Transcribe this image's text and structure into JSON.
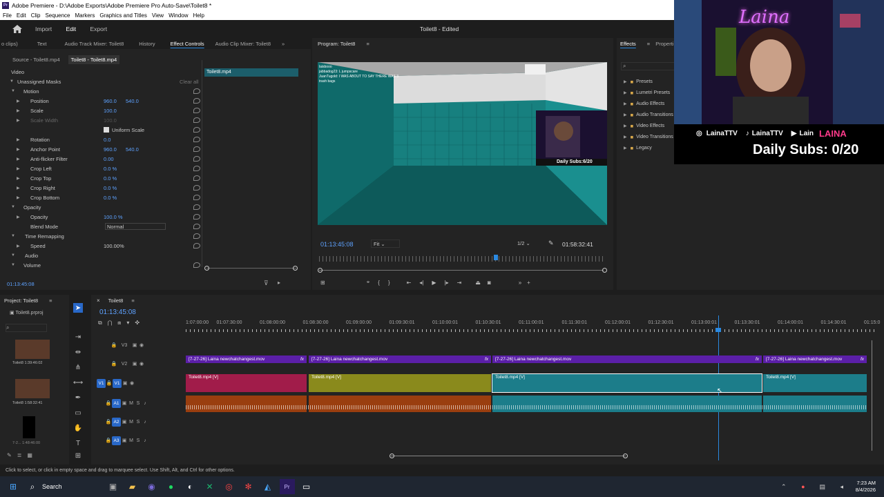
{
  "window": {
    "title": "Adobe Premiere - D:\\Adobe Exports\\Adobe Premiere Pro Auto-Save\\Toilet8 *",
    "logo": "Pr"
  },
  "menu": [
    "File",
    "Edit",
    "Clip",
    "Sequence",
    "Markers",
    "Graphics and Titles",
    "View",
    "Window",
    "Help"
  ],
  "appbar": {
    "import": "Import",
    "edit": "Edit",
    "export": "Export",
    "doc": "Toilet8 - Edited"
  },
  "panel_tabs": {
    "clips": "o clips)",
    "text": "Text",
    "audio_track_mixer": "Audio Track Mixer: Toilet8",
    "history": "History",
    "effect_controls": "Effect Controls",
    "audio_clip_mixer": "Audio Clip Mixer: Toilet8",
    "program": "Program: Toilet8",
    "effects": "Effects",
    "properties": "Properti"
  },
  "effect_controls": {
    "source": "Source - Toilet8.mp4",
    "seq": "Toilet8 - Toilet8.mp4",
    "clip": "Toilet8.mp4",
    "video": "Video",
    "masks": "Unassigned Masks",
    "clear_all": "Clear all",
    "rows": [
      {
        "label": "Motion",
        "v1": "",
        "v2": ""
      },
      {
        "label": "Position",
        "v1": "960.0",
        "v2": "540.0"
      },
      {
        "label": "Scale",
        "v1": "100.0",
        "v2": ""
      },
      {
        "label": "Scale Width",
        "v1": "100.0",
        "v2": ""
      },
      {
        "label": "Uniform Scale",
        "v1": "",
        "v2": ""
      },
      {
        "label": "Rotation",
        "v1": "0.0",
        "v2": ""
      },
      {
        "label": "Anchor Point",
        "v1": "960.0",
        "v2": "540.0"
      },
      {
        "label": "Anti-flicker Filter",
        "v1": "0.00",
        "v2": ""
      },
      {
        "label": "Crop Left",
        "v1": "0.0 %",
        "v2": ""
      },
      {
        "label": "Crop Top",
        "v1": "0.0 %",
        "v2": ""
      },
      {
        "label": "Crop Right",
        "v1": "0.0 %",
        "v2": ""
      },
      {
        "label": "Crop Bottom",
        "v1": "0.0 %",
        "v2": ""
      },
      {
        "label": "Opacity",
        "v1": "",
        "v2": ""
      },
      {
        "label": "Opacity",
        "v1": "100.0 %",
        "v2": ""
      },
      {
        "label": "Blend Mode",
        "v1": "Normal",
        "v2": ""
      },
      {
        "label": "Time Remapping",
        "v1": "",
        "v2": ""
      },
      {
        "label": "Speed",
        "v1": "100.00%",
        "v2": ""
      },
      {
        "label": "Audio",
        "v1": "",
        "v2": ""
      },
      {
        "label": "Volume",
        "v1": "",
        "v2": ""
      }
    ],
    "timecode": "01:13:45:08"
  },
  "program": {
    "timecode": "01:13:45:08",
    "fit": "Fit",
    "res": "1/2",
    "duration": "01:58:32:41",
    "chat": [
      "laisbooo",
      "jabbadog23: L jumpscare",
      "JuanTugold: I WAS ABOUT TO SAY THERE WAS 3",
      "trash bags"
    ],
    "inner_overlay": "Daily Subs:6/20"
  },
  "effects": {
    "items": [
      "Presets",
      "Lumetri Presets",
      "Audio Effects",
      "Audio Transitions",
      "Video Effects",
      "Video Transitions",
      "Legacy"
    ]
  },
  "webcam": {
    "name": "Laina",
    "social": [
      "LainaTTV",
      "LainaTTV",
      "Lain"
    ],
    "brand": "LAINA",
    "subs": "Daily Subs: 0/20"
  },
  "project": {
    "title": "Project: Toilet8",
    "file": "Toilet8.prproj",
    "items": [
      {
        "name": "Toilet8",
        "dur": "1:39:46:02"
      },
      {
        "name": "Toilet8",
        "dur": "1:58:32:41"
      },
      {
        "name": "7-2...",
        "dur": "1:48:46:00"
      }
    ]
  },
  "timeline": {
    "tab": "Toilet8",
    "timecode": "01:13:45:08",
    "ruler": [
      "1:07:00:00",
      "01:07:30:00",
      "01:08:00:00",
      "01:08:30:00",
      "01:09:00:00",
      "01:09:30:01",
      "01:10:00:01",
      "01:10:30:01",
      "01:11:00:01",
      "01:11:30:01",
      "01:12:00:01",
      "01:12:30:01",
      "01:13:00:01",
      "01:13:30:01",
      "01:14:00:01",
      "01:14:30:01",
      "01:15:0"
    ],
    "tracks": [
      "V3",
      "V2",
      "V1",
      "A1",
      "A2",
      "A3"
    ],
    "v2clip": "[7-27-26] Laina newchatchangest.mov",
    "v1clip": "Toilet8.mp4 [V]",
    "fx": "fx"
  },
  "status": "Click to select, or click in empty space and drag to marquee select. Use Shift, Alt, and Ctrl for other options.",
  "taskbar": {
    "search": "Search",
    "time": "7:23 AM",
    "date": "8/4/2026"
  },
  "colors": {
    "v2": "#5b1fa8",
    "v1a": "#a11c4a",
    "v1b": "#8a8a1c",
    "v1c": "#1c7d8a",
    "a1a": "#9a3e0f",
    "a1c": "#1c7d8a",
    "accent": "#2b8ae2"
  }
}
